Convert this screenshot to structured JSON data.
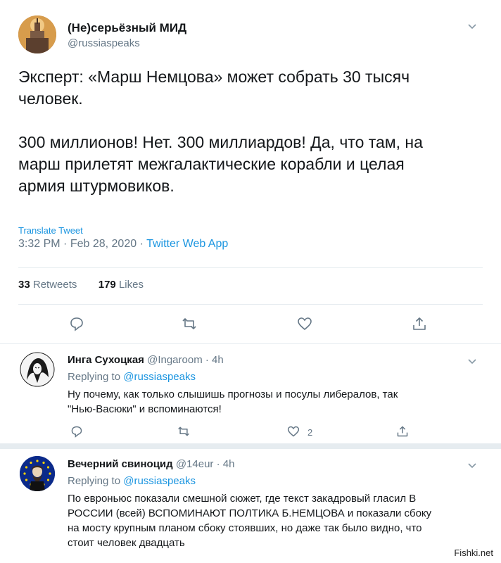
{
  "main_tweet": {
    "author_name": "(Не)серьёзный МИД",
    "handle": "@russiaspeaks",
    "text": "Эксперт: «Марш Немцова» может собрать 30 тысяч\nчеловек.\n\n300 миллионов! Нет. 300 миллиардов! Да, что там, на\nмарш прилетят межгалактические корабли и целая\nармия штурмовиков.",
    "translate_label": "Translate Tweet",
    "time": "3:32 PM",
    "date": "Feb 28, 2020",
    "source": "Twitter Web App",
    "retweets_count": "33",
    "retweets_label": "Retweets",
    "likes_count": "179",
    "likes_label": "Likes"
  },
  "replies": [
    {
      "author_name": "Инга Сухоцкая",
      "handle": "@Ingaroom",
      "age": "4h",
      "replying_prefix": "Replying to",
      "replying_to": "@russiaspeaks",
      "text_line1": "Ну почему, как только слышишь прогнозы и посулы либералов, так",
      "text_line2": "\"Нью-Васюки\" и вспоминаются!",
      "likes_count": "2"
    },
    {
      "author_name": "Вечерний свиноцид",
      "handle": "@14eur",
      "age": "4h",
      "replying_prefix": "Replying to",
      "replying_to": "@russiaspeaks",
      "text_line1": "По евроньюс показали смешной сюжет, где текст закадровый гласил В",
      "text_line2": "РОССИИ (всей) ВСПОМИНАЮТ ПОЛТИКА Б.НЕМЦОВА и показали сбоку",
      "text_line3": "на мосту крупным планом сбоку стоявших, но даже так было видно, что",
      "text_line4": "стоит человек двадцать"
    }
  ],
  "watermark": "Fishki.net",
  "icons": [
    "chevron-down-icon",
    "reply-icon",
    "retweet-icon",
    "like-icon",
    "share-icon"
  ],
  "colors": {
    "link": "#1b95e0",
    "muted": "#657786",
    "divider": "#e6ecf0"
  }
}
